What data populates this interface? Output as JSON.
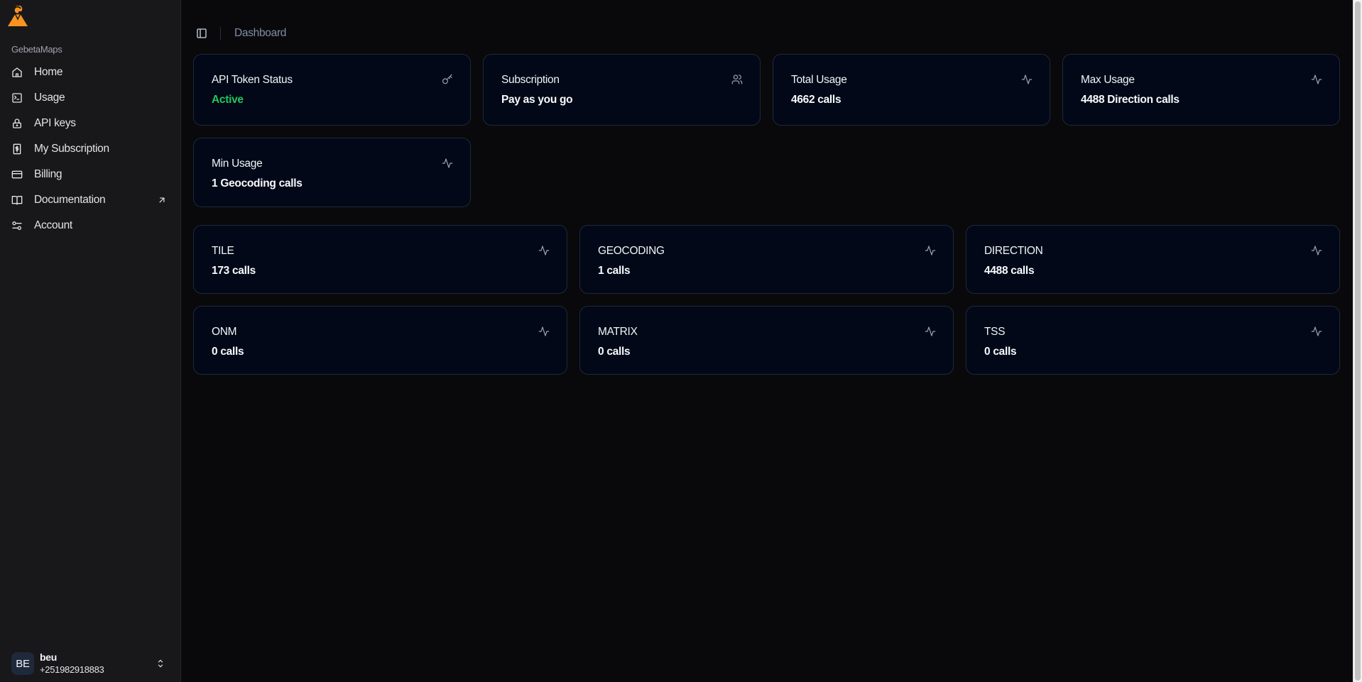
{
  "sidebar": {
    "brand": "GebetaMaps",
    "items": [
      {
        "label": "Home"
      },
      {
        "label": "Usage"
      },
      {
        "label": "API keys"
      },
      {
        "label": "My Subscription"
      },
      {
        "label": "Billing"
      },
      {
        "label": "Documentation"
      },
      {
        "label": "Account"
      }
    ],
    "user": {
      "initials": "BE",
      "name": "beu",
      "phone": "+251982918883"
    }
  },
  "header": {
    "breadcrumb": "Dashboard"
  },
  "summary_cards": [
    {
      "title": "API Token Status",
      "value": "Active",
      "icon": "key-icon"
    },
    {
      "title": "Subscription",
      "value": "Pay as you go",
      "icon": "users-icon"
    },
    {
      "title": "Total Usage",
      "value": "4662 calls",
      "icon": "activity-icon"
    },
    {
      "title": "Max Usage",
      "value": "4488 Direction calls",
      "icon": "activity-icon"
    },
    {
      "title": "Min Usage",
      "value": "1 Geocoding calls",
      "icon": "activity-icon"
    }
  ],
  "service_cards": [
    {
      "title": "TILE",
      "value": "173 calls"
    },
    {
      "title": "GEOCODING",
      "value": "1 calls"
    },
    {
      "title": "DIRECTION",
      "value": "4488 calls"
    },
    {
      "title": "ONM",
      "value": "0 calls"
    },
    {
      "title": "MATRIX",
      "value": "0 calls"
    },
    {
      "title": "TSS",
      "value": "0 calls"
    }
  ],
  "colors": {
    "accent": "#f7931e",
    "active": "#22c55e",
    "card_bg": "#020817",
    "sidebar_bg": "#18181b"
  }
}
